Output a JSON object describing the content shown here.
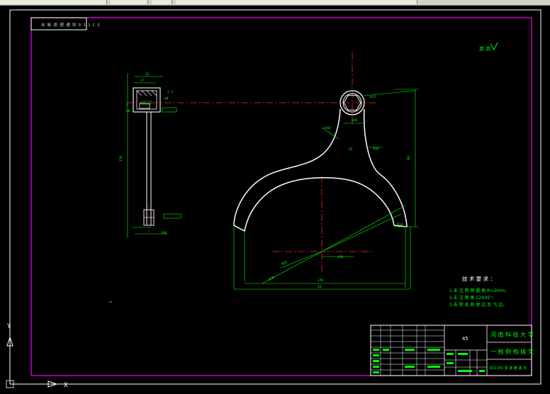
{
  "app": {
    "background": "#000000"
  },
  "colors": {
    "border": "#ff00ff",
    "outline": "#ffffff",
    "centerline": "#ff2020",
    "dimension": "#00ff00",
    "annotation": "#ffff00"
  },
  "toolbar": {
    "visible": true
  },
  "drawing": {
    "title_note": "去 制 原 理 通 知 D 1 1 C S",
    "roughness_label": "其 余",
    "tech_requirements": {
      "title": "技 术 要 求 ：",
      "items": [
        "1.未 注 明 倒 圆 角 R=2mm；",
        "2.未 注 倒 角 C2X45°；",
        "3.去 除 毛 刺 锐 边 及 飞 边。"
      ]
    },
    "title_block": {
      "material": "45",
      "university": "河 南 科 技 大 学",
      "part_name": "一 档 倒 档 拨 叉",
      "drawing_number": "XD1150 变 速 器 拨 叉"
    },
    "dimensions": [
      "22",
      "17",
      "ø8",
      "2.5",
      "5",
      "R6",
      "178",
      "ø15",
      "ø28",
      "ø30",
      "R8",
      "R18",
      "45",
      "R20",
      "R14",
      "R70",
      "R65",
      "170",
      "194",
      "16"
    ],
    "ucs": {
      "x_label": "X",
      "y_label": "Y"
    }
  }
}
